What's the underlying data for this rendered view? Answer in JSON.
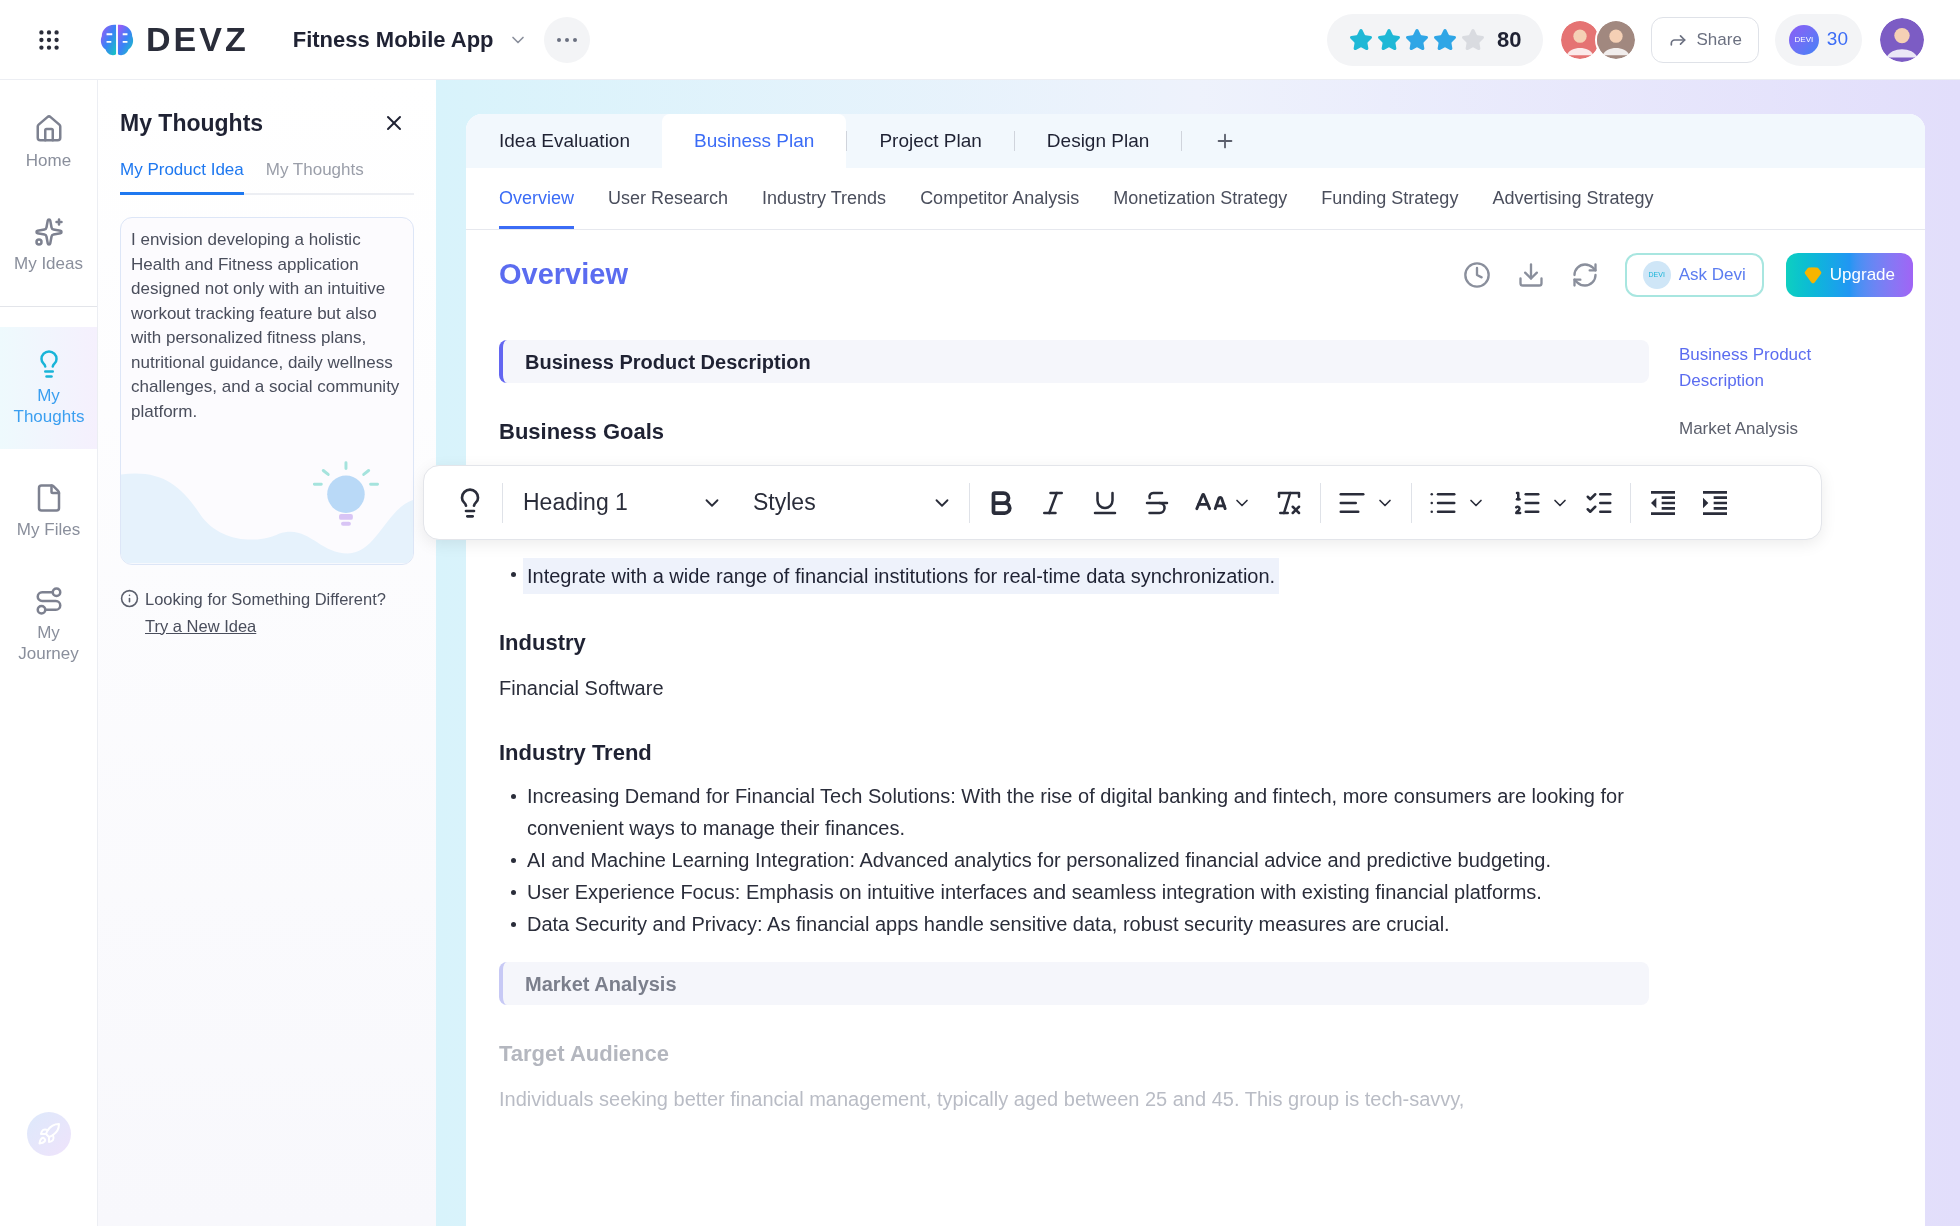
{
  "app_bar": {
    "brand": "DEVZ",
    "project": "Fitness Mobile App",
    "rating": {
      "stars": 4,
      "score": "80"
    },
    "share": "Share",
    "credits_badge": "DEVI",
    "credits": "30"
  },
  "nav": [
    {
      "label": "Home",
      "selected": false
    },
    {
      "label": "My Ideas",
      "selected": false
    },
    {
      "label": "My Thoughts",
      "selected": true
    },
    {
      "label": "My Files",
      "selected": false
    },
    {
      "label": "My Journey",
      "selected": false
    }
  ],
  "thoughts_panel": {
    "title": "My Thoughts",
    "tabs": [
      {
        "label": "My Product Idea",
        "selected": true
      },
      {
        "label": "My Thoughts",
        "selected": false
      }
    ],
    "idea": "I envision developing a holistic Health and Fitness application designed not only with an intuitive workout tracking feature but also with personalized fitness plans, nutritional guidance, daily wellness challenges, and a social community platform.",
    "hint": "Looking for Something Different?",
    "link": "Try a New Idea"
  },
  "plan_tabs": [
    {
      "label": "Idea Evaluation",
      "selected": false
    },
    {
      "label": "Business Plan",
      "selected": true
    },
    {
      "label": "Project Plan",
      "selected": false
    },
    {
      "label": "Design Plan",
      "selected": false
    }
  ],
  "section_tabs": [
    {
      "label": "Overview",
      "selected": true
    },
    {
      "label": "User Research",
      "selected": false
    },
    {
      "label": "Industry Trends",
      "selected": false
    },
    {
      "label": "Competitor Analysis",
      "selected": false
    },
    {
      "label": "Monetization Strategy",
      "selected": false
    },
    {
      "label": "Funding Strategy",
      "selected": false
    },
    {
      "label": "Advertising Strategy",
      "selected": false
    }
  ],
  "page": {
    "title": "Overview",
    "ask": "Ask Devi",
    "ask_badge": "DEVI",
    "upgrade": "Upgrade"
  },
  "toc": [
    {
      "label": "Business Product Description",
      "selected": true
    },
    {
      "label": "Market Analysis",
      "selected": false
    }
  ],
  "toolbar": {
    "block": "Heading 1",
    "styles": "Styles"
  },
  "content": [
    {
      "kind": "banner",
      "text": "Business Product Description",
      "faded": false
    },
    {
      "kind": "heading",
      "text": "Business Goals",
      "faded": false
    },
    {
      "kind": "bullets",
      "faded": false,
      "items": [
        {
          "text": "Integrate with a wide range of financial institutions for real-time data synchronization.",
          "highlighted": true
        }
      ]
    },
    {
      "kind": "heading",
      "text": "Industry",
      "faded": false
    },
    {
      "kind": "paragraph",
      "text": "Financial Software",
      "faded": false
    },
    {
      "kind": "heading",
      "text": "Industry Trend",
      "faded": false
    },
    {
      "kind": "bullets",
      "faded": false,
      "items": [
        {
          "text": "Increasing Demand for Financial Tech Solutions: With the rise of digital banking and fintech, more consumers are looking for convenient ways to manage their finances.",
          "highlighted": false
        },
        {
          "text": "AI and Machine Learning Integration: Advanced analytics for personalized financial advice and predictive budgeting.",
          "highlighted": false
        },
        {
          "text": "User Experience Focus: Emphasis on intuitive interfaces and seamless integration with existing financial platforms.",
          "highlighted": false
        },
        {
          "text": "Data Security and Privacy: As financial apps handle sensitive data, robust security measures are crucial.",
          "highlighted": false
        }
      ]
    },
    {
      "kind": "banner",
      "text": "Market Analysis",
      "faded": true
    },
    {
      "kind": "heading",
      "text": "Target Audience",
      "faded": true
    },
    {
      "kind": "paragraph",
      "text": "Individuals seeking better financial management, typically aged between 25 and 45. This group is tech-savvy,",
      "faded": true
    }
  ]
}
